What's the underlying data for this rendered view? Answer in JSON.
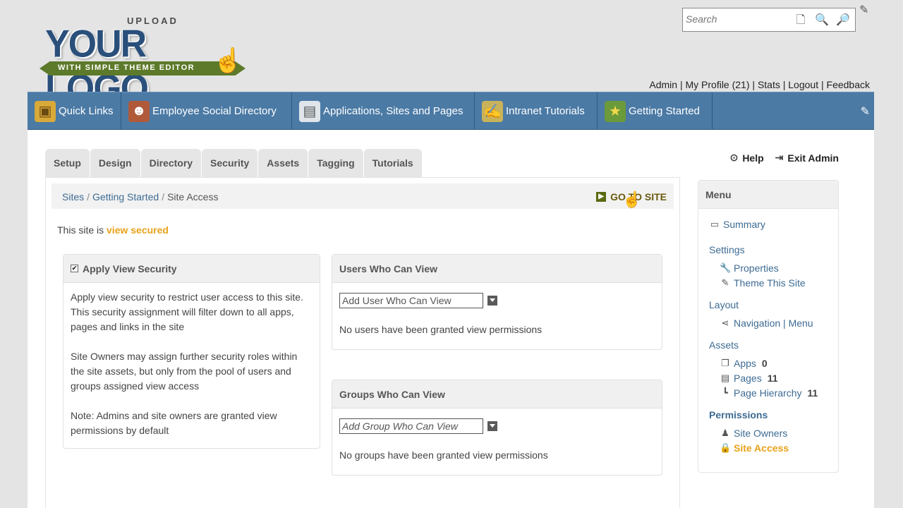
{
  "logo": {
    "upload": "UPLOAD",
    "main": "YOUR LOGO",
    "ribbon": "WITH SIMPLE THEME EDITOR"
  },
  "search": {
    "placeholder": "Search"
  },
  "toplinks": {
    "admin": "Admin",
    "profile": "My Profile (21)",
    "stats": "Stats",
    "logout": "Logout",
    "feedback": "Feedback",
    "sep": " | "
  },
  "nav": [
    {
      "label": "Quick Links",
      "icon": "folder-icon"
    },
    {
      "label": "Employee Social Directory",
      "icon": "people-icon"
    },
    {
      "label": "Applications, Sites and Pages",
      "icon": "document-icon"
    },
    {
      "label": "Intranet Tutorials",
      "icon": "tutorial-icon"
    },
    {
      "label": "Getting Started",
      "icon": "star-icon"
    }
  ],
  "tabs": [
    "Setup",
    "Design",
    "Directory",
    "Security",
    "Assets",
    "Tagging",
    "Tutorials"
  ],
  "breadcrumb": {
    "sites": "Sites",
    "getting_started": "Getting Started",
    "current": "Site Access",
    "sep": "/"
  },
  "goto_site": "GO TO SITE",
  "help": "Help",
  "exit_admin": "Exit Admin",
  "secured": {
    "prefix": "This site is ",
    "status": "view secured"
  },
  "apply_box": {
    "title": "Apply View Security",
    "p1": "Apply view security to restrict user access to this site. This security assignment will filter down to all apps, pages and links in the site",
    "p2": "Site Owners may assign further security roles within the site assets, but only from the pool of users and groups assigned view access",
    "p3": "Note: Admins and site owners are granted view permissions by default"
  },
  "users_box": {
    "title": "Users Who Can View",
    "input_value": "Add User Who Can View",
    "empty": "No users have been granted view permissions"
  },
  "groups_box": {
    "title": "Groups Who Can View",
    "input_value": "Add Group Who Can View",
    "empty": "No groups have been granted view permissions"
  },
  "menu": {
    "title": "Menu",
    "summary": "Summary",
    "settings": "Settings",
    "properties": "Properties",
    "theme": "Theme This Site",
    "layout": "Layout",
    "navigation": "Navigation | Menu",
    "assets": "Assets",
    "apps": "Apps",
    "apps_count": "0",
    "pages": "Pages",
    "pages_count": "11",
    "hierarchy": "Page Hierarchy",
    "hierarchy_count": "11",
    "permissions": "Permissions",
    "site_owners": "Site Owners",
    "site_access": "Site Access"
  },
  "colors": {
    "nav": "#4b7aa5",
    "accent": "#e8a21a",
    "link": "#3d6b93"
  }
}
